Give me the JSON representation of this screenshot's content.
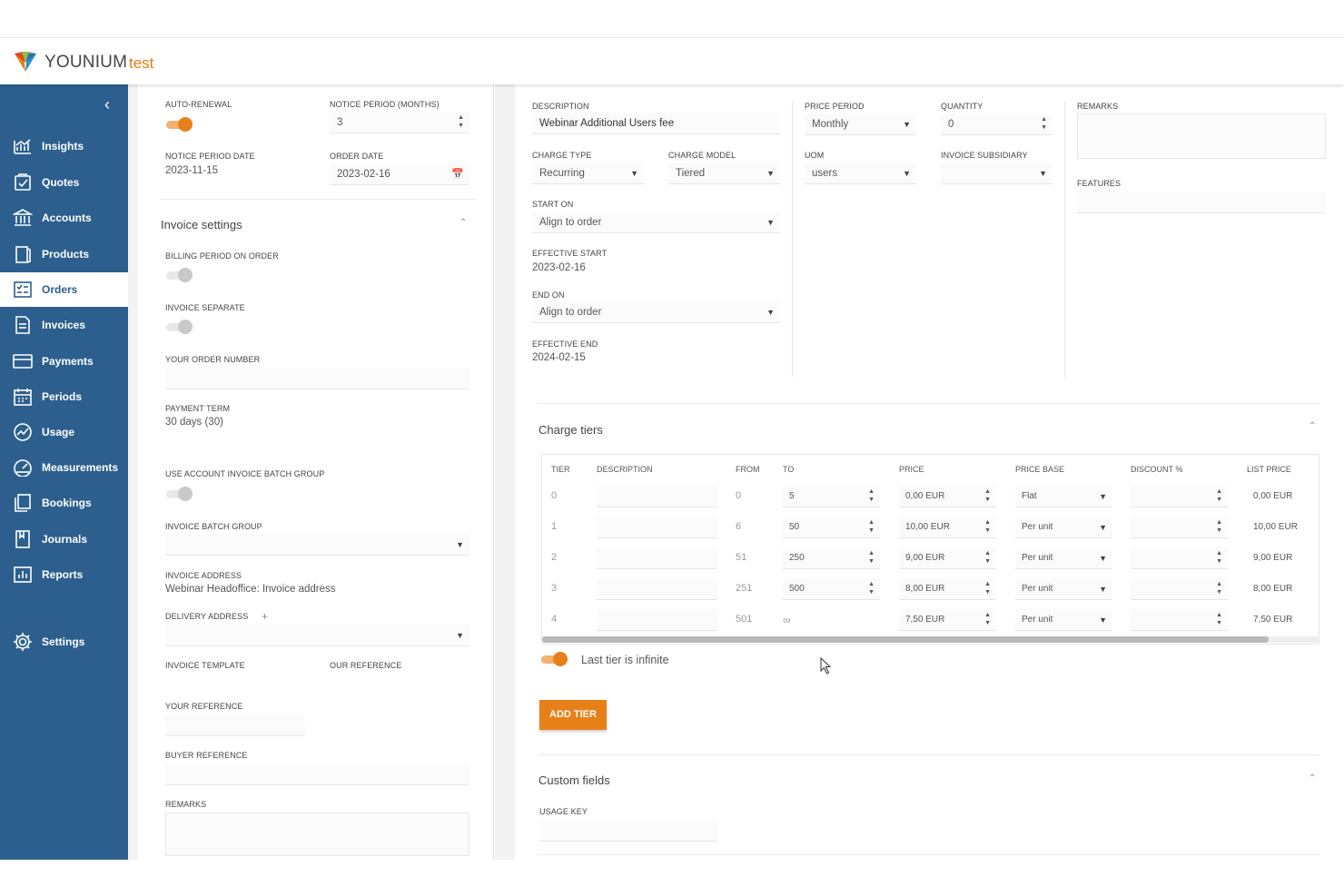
{
  "brand": {
    "name": "YOUNIUM",
    "env": "test",
    "accent": "#e8801a",
    "sidebar_color": "#2d5f8e"
  },
  "sidebar": {
    "collapse_icon": "chevron-left-icon",
    "items": [
      {
        "label": "Insights",
        "icon": "chart-line-icon"
      },
      {
        "label": "Quotes",
        "icon": "quote-icon"
      },
      {
        "label": "Accounts",
        "icon": "bank-icon"
      },
      {
        "label": "Products",
        "icon": "product-icon"
      },
      {
        "label": "Orders",
        "icon": "orders-icon",
        "active": true
      },
      {
        "label": "Invoices",
        "icon": "invoice-icon"
      },
      {
        "label": "Payments",
        "icon": "card-icon"
      },
      {
        "label": "Periods",
        "icon": "calendar-icon"
      },
      {
        "label": "Usage",
        "icon": "usage-icon"
      },
      {
        "label": "Measurements",
        "icon": "gauge-icon"
      },
      {
        "label": "Bookings",
        "icon": "book-icon"
      },
      {
        "label": "Journals",
        "icon": "journal-icon"
      },
      {
        "label": "Reports",
        "icon": "report-icon"
      },
      {
        "label": "Settings",
        "icon": "gear-icon"
      }
    ]
  },
  "left": {
    "auto_renewal_label": "AUTO-RENEWAL",
    "notice_period_label": "NOTICE PERIOD (MONTHS)",
    "notice_period_value": "3",
    "notice_period_date_label": "NOTICE PERIOD DATE",
    "notice_period_date_value": "2023-11-15",
    "order_date_label": "ORDER DATE",
    "order_date_value": "2023-02-16",
    "invoice_settings_title": "Invoice settings",
    "billing_period_label": "BILLING PERIOD ON ORDER",
    "invoice_separate_label": "INVOICE SEPARATE",
    "your_order_number_label": "YOUR ORDER NUMBER",
    "payment_term_label": "PAYMENT TERM",
    "payment_term_value": "30 days (30)",
    "use_batch_label": "USE ACCOUNT INVOICE BATCH GROUP",
    "batch_group_label": "INVOICE BATCH GROUP",
    "invoice_address_label": "INVOICE ADDRESS",
    "invoice_address_value": "Webinar Headoffice: Invoice address",
    "delivery_address_label": "DELIVERY ADDRESS",
    "invoice_template_label": "INVOICE TEMPLATE",
    "our_reference_label": "OUR REFERENCE",
    "your_reference_label": "YOUR REFERENCE",
    "buyer_reference_label": "BUYER REFERENCE",
    "remarks_label": "REMARKS"
  },
  "right": {
    "description_label": "DESCRIPTION",
    "description_value": "Webinar Additional Users fee",
    "price_period_label": "PRICE PERIOD",
    "price_period_value": "Monthly",
    "quantity_label": "QUANTITY",
    "quantity_value": "0",
    "remarks_label": "REMARKS",
    "charge_type_label": "CHARGE TYPE",
    "charge_type_value": "Recurring",
    "charge_model_label": "CHARGE MODEL",
    "charge_model_value": "Tiered",
    "uom_label": "UOM",
    "uom_value": "users",
    "invoice_subsidiary_label": "INVOICE SUBSIDIARY",
    "features_label": "FEATURES",
    "start_on_label": "START ON",
    "start_on_value": "Align to order",
    "effective_start_label": "EFFECTIVE START",
    "effective_start_value": "2023-02-16",
    "end_on_label": "END ON",
    "end_on_value": "Align to order",
    "effective_end_label": "EFFECTIVE END",
    "effective_end_value": "2024-02-15",
    "charge_tiers_title": "Charge tiers",
    "last_tier_label": "Last tier is infinite",
    "add_tier_label": "ADD TIER",
    "custom_fields_title": "Custom fields",
    "usage_key_label": "USAGE KEY"
  },
  "tiers": {
    "headers": [
      "TIER",
      "DESCRIPTION",
      "FROM",
      "TO",
      "PRICE",
      "PRICE BASE",
      "DISCOUNT %",
      "LIST PRICE"
    ],
    "rows": [
      {
        "tier": "0",
        "from": "0",
        "to": "5",
        "price": "0,00 EUR",
        "base": "Flat",
        "list": "0,00 EUR"
      },
      {
        "tier": "1",
        "from": "6",
        "to": "50",
        "price": "10,00 EUR",
        "base": "Per unit",
        "list": "10,00 EUR"
      },
      {
        "tier": "2",
        "from": "51",
        "to": "250",
        "price": "9,00 EUR",
        "base": "Per unit",
        "list": "9,00 EUR"
      },
      {
        "tier": "3",
        "from": "251",
        "to": "500",
        "price": "8,00 EUR",
        "base": "Per unit",
        "list": "8,00 EUR"
      },
      {
        "tier": "4",
        "from": "501",
        "to": "∞",
        "price": "7,50 EUR",
        "base": "Per unit",
        "list": "7,50 EUR"
      }
    ]
  }
}
